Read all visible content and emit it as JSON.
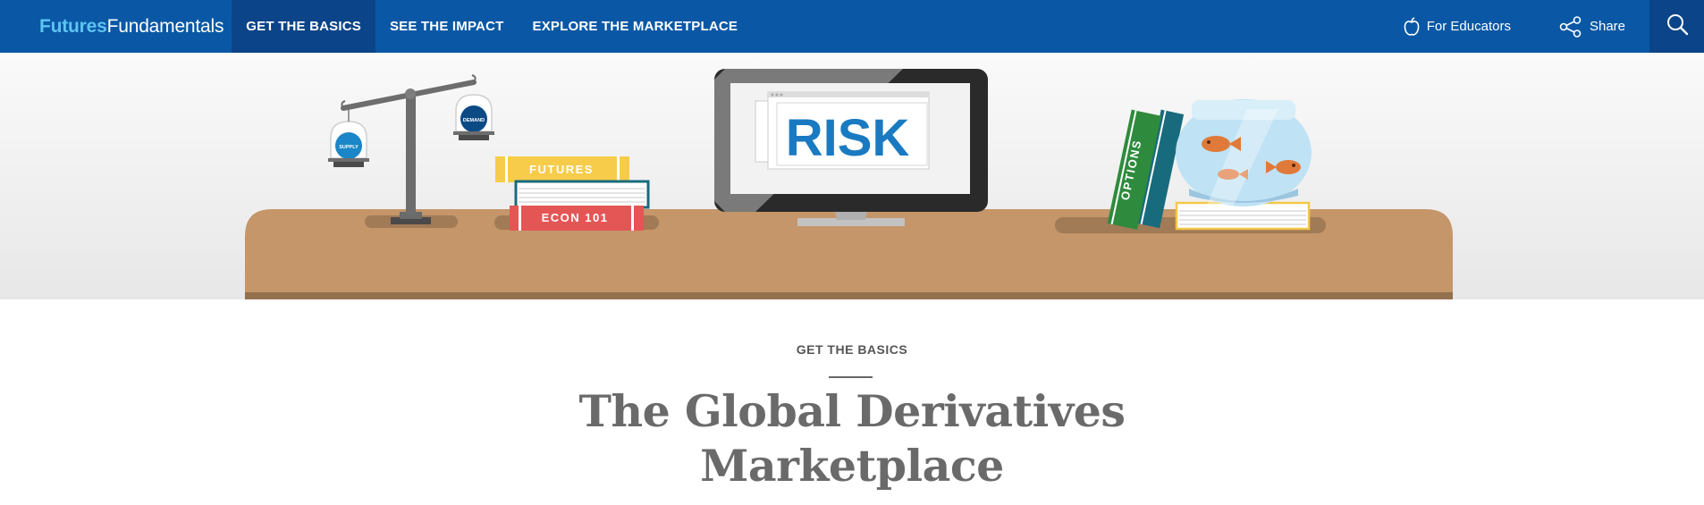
{
  "brand": {
    "name_bold": "Futures",
    "name_light": "Fundamentals"
  },
  "nav": {
    "items": [
      {
        "label": "GET THE BASICS",
        "active": true
      },
      {
        "label": "SEE THE IMPACT",
        "active": false
      },
      {
        "label": "EXPLORE THE MARKETPLACE",
        "active": false
      }
    ]
  },
  "utility": {
    "educators_label": "For Educators",
    "educators_icon": "apple-icon",
    "share_label": "Share",
    "share_icon": "share-icon",
    "search_icon": "search-icon"
  },
  "hero": {
    "scale": {
      "left_label": "SUPPLY",
      "right_label": "DEMAND"
    },
    "books": {
      "top": "FUTURES",
      "bottom": "ECON 101",
      "side": "OPTIONS"
    },
    "monitor_text": "RISK"
  },
  "page": {
    "eyebrow": "GET THE BASICS",
    "title_line1": "The Global Derivatives",
    "title_line2": "Marketplace"
  },
  "colors": {
    "nav_bg": "#0a58a5",
    "nav_active": "#0b4488",
    "brand_accent": "#5ec3f2",
    "desk": "#c4966a",
    "risk_text": "#1a7ac1"
  }
}
